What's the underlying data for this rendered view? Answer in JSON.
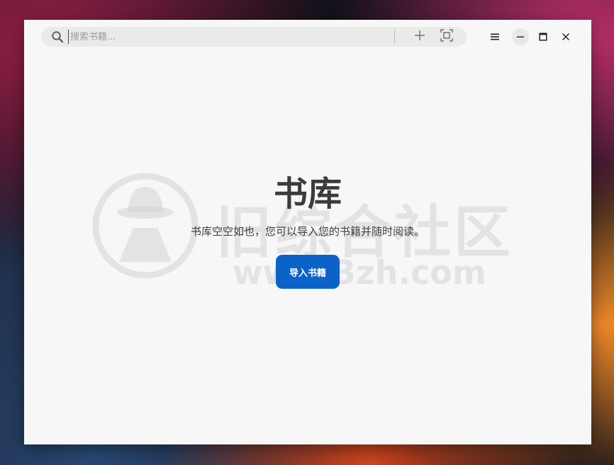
{
  "search": {
    "placeholder": "搜索书籍...",
    "value": ""
  },
  "toolbar": {
    "icons": [
      "search-icon",
      "plus-icon",
      "scan-icon",
      "hamburger-menu-icon",
      "minimize-icon",
      "maximize-icon",
      "close-icon"
    ]
  },
  "library": {
    "title": "书库",
    "empty_message": "书库空空如也，您可以导入您的书籍并随时阅读。",
    "import_button_label": "导入书籍"
  },
  "watermark": {
    "brand_text": "旧综合社区",
    "url_text": "www.3zh.com"
  },
  "colors": {
    "accent": "#0b63c9",
    "window_bg": "#f7f7f7",
    "searchbar_bg": "#e9eaea",
    "title_text": "#3b3b3b"
  }
}
